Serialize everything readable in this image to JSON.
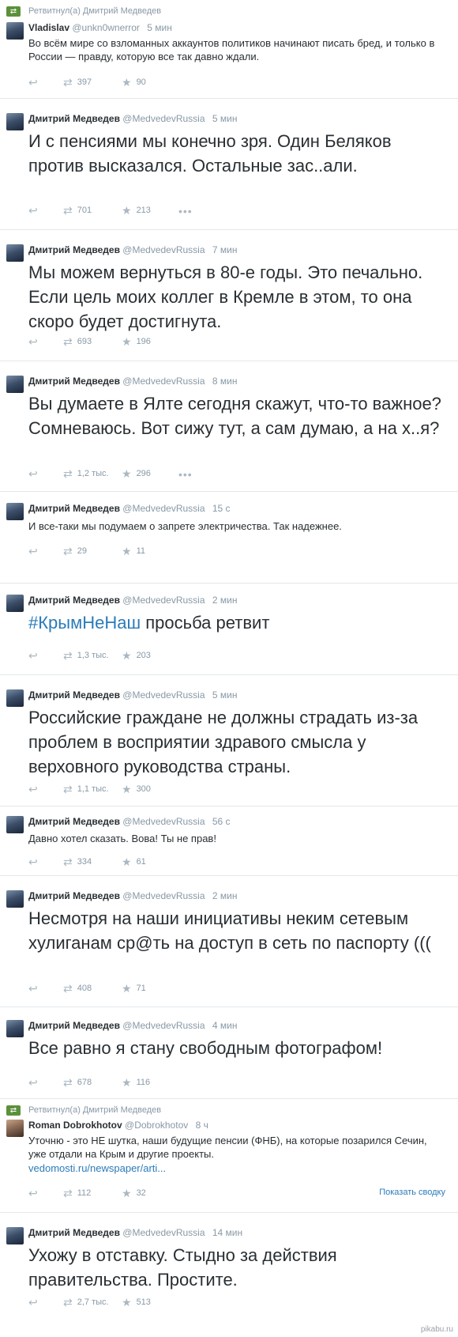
{
  "tweets": [
    {
      "retweeted_by": "Ретвитнул(а) Дмитрий Медведев",
      "name": "Vladislav",
      "handle": "@unkn0wnerror",
      "time": "5 мин",
      "text": "Во всём мире со взломанных аккаунтов политиков начинают писать бред, и только в России — правду, которую все так давно ждали.",
      "retweets": "397",
      "favorites": "90"
    },
    {
      "name": "Дмитрий Медведев",
      "handle": "@MedvedevRussia",
      "time": "5 мин",
      "text": "И с пенсиями мы конечно зря. Один Беляков против высказался. Остальные зас..али.",
      "retweets": "701",
      "favorites": "213"
    },
    {
      "name": "Дмитрий Медведев",
      "handle": "@MedvedevRussia",
      "time": "7 мин",
      "text": "Мы можем вернуться в 80-е годы. Это печально. Если цель моих коллег в Кремле в этом, то она скоро будет достигнута.",
      "retweets": "693",
      "favorites": "196"
    },
    {
      "name": "Дмитрий Медведев",
      "handle": "@MedvedevRussia",
      "time": "8 мин",
      "text": "Вы думаете в Ялте сегодня скажут, что-то важное? Сомневаюсь. Вот сижу тут, а сам думаю, а на х..я?",
      "retweets": "1,2 тыс.",
      "favorites": "296"
    },
    {
      "name": "Дмитрий Медведев",
      "handle": "@MedvedevRussia",
      "time": "15 с",
      "text": "И все-таки мы подумаем о запрете электричества. Так надежнее.",
      "retweets": "29",
      "favorites": "11"
    },
    {
      "name": "Дмитрий Медведев",
      "handle": "@MedvedevRussia",
      "time": "2 мин",
      "hashtag": "#КрымНеНаш",
      "text": " просьба ретвит",
      "retweets": "1,3 тыс.",
      "favorites": "203"
    },
    {
      "name": "Дмитрий Медведев",
      "handle": "@MedvedevRussia",
      "time": "5 мин",
      "text": "Российские граждане не должны страдать из-за проблем в восприятии здравого смысла у верховного руководства страны.",
      "retweets": "1,1 тыс.",
      "favorites": "300"
    },
    {
      "name": "Дмитрий Медведев",
      "handle": "@MedvedevRussia",
      "time": "56 с",
      "text": "Давно хотел сказать. Вова! Ты не прав!",
      "retweets": "334",
      "favorites": "61"
    },
    {
      "name": "Дмитрий Медведев",
      "handle": "@MedvedevRussia",
      "time": "2 мин",
      "text": "Несмотря на наши инициативы неким сетевым хулиганам ср@ть на доступ в сеть по паспорту  (((",
      "retweets": "408",
      "favorites": "71"
    },
    {
      "name": "Дмитрий Медведев",
      "handle": "@MedvedevRussia",
      "time": "4 мин",
      "text": "Все равно я стану свободным фотографом!",
      "retweets": "678",
      "favorites": "116"
    },
    {
      "retweeted_by": "Ретвитнул(а) Дмитрий Медведев",
      "name": "Roman Dobrokhotov",
      "handle": "@Dobrokhotov",
      "time": "8 ч",
      "text": "Уточню - это НЕ шутка, наши будущие пенсии (ФНБ), на которые позарился Сечин, уже отдали на Крым и другие проекты.",
      "link": "vedomosti.ru/newspaper/arti...",
      "summary": "Показать сводку",
      "retweets": "112",
      "favorites": "32"
    },
    {
      "name": "Дмитрий Медведев",
      "handle": "@MedvedevRussia",
      "time": "14 мин",
      "text": "Ухожу в отставку. Стыдно за действия правительства. Простите.",
      "retweets": "2,7 тыс.",
      "favorites": "513"
    }
  ],
  "icons": {
    "reply": "reply-icon",
    "retweet": "retweet-icon",
    "favorite": "star-icon",
    "more": "more-icon"
  },
  "colors": {
    "link": "#2b7bb9",
    "meta": "#8899a6",
    "retweet_green": "#5c913b"
  },
  "watermark": "pikabu.ru"
}
